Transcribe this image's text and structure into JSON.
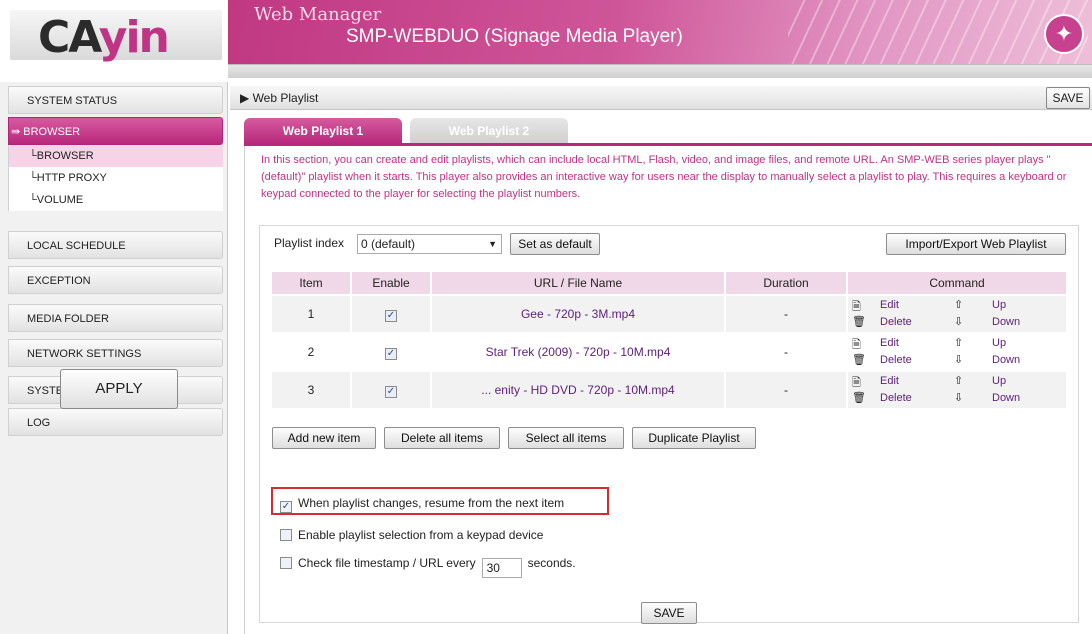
{
  "logo": {
    "text_a": "CA",
    "text_b": "yin"
  },
  "header": {
    "title": "Web Manager",
    "subtitle": "SMP-WEBDUO (Signage Media Player)",
    "badge_icon": "wand-icon"
  },
  "sidebar": {
    "items": [
      {
        "label": "SYSTEM STATUS"
      },
      {
        "label": "BROWSER"
      },
      {
        "label": "LOCAL SCHEDULE"
      },
      {
        "label": "EXCEPTION"
      },
      {
        "label": "MEDIA FOLDER"
      },
      {
        "label": "NETWORK SETTINGS"
      },
      {
        "label": "SYSTEM"
      },
      {
        "label": "LOG"
      }
    ],
    "subitems": [
      {
        "label": "BROWSER"
      },
      {
        "label": "HTTP PROXY"
      },
      {
        "label": "VOLUME"
      }
    ],
    "apply_label": "APPLY"
  },
  "breadcrumb": "Web Playlist",
  "top_save_label": "SAVE",
  "tabs": [
    {
      "label": "Web Playlist 1"
    },
    {
      "label": "Web Playlist 2"
    }
  ],
  "description": "In this section, you can create and edit playlists, which can include local HTML, Flash, video, and image files, and remote URL. An SMP-WEB series player plays \"(default)\" playlist when it starts. This player also provides an interactive way for users near the display to manually select a playlist to play. This requires a keyboard or keypad connected to the player for selecting the playlist numbers.",
  "playlist": {
    "index_label": "Playlist index",
    "index_value": "0 (default)",
    "set_default_label": "Set as default",
    "import_export_label": "Import/Export Web Playlist",
    "columns": [
      "Item",
      "Enable",
      "URL / File Name",
      "Duration",
      "Command"
    ],
    "rows": [
      {
        "item": "1",
        "file": "Gee - 720p - 3M.mp4",
        "duration": "-"
      },
      {
        "item": "2",
        "file": "Star Trek (2009) - 720p - 10M.mp4",
        "duration": "-"
      },
      {
        "item": "3",
        "file": "... enity - HD DVD - 720p - 10M.mp4",
        "duration": "-"
      }
    ],
    "commands": {
      "edit": "Edit",
      "delete": "Delete",
      "up": "Up",
      "down": "Down"
    }
  },
  "actions": {
    "add": "Add new item",
    "delete_all": "Delete all items",
    "select_all": "Select all items",
    "duplicate": "Duplicate Playlist"
  },
  "options": {
    "resume": "When playlist changes, resume from the next item",
    "keypad": "Enable playlist selection from a keypad device",
    "check_prefix": "Check file timestamp / URL every",
    "check_value": "30",
    "check_suffix": "seconds."
  },
  "bottom_save_label": "SAVE",
  "colors": {
    "accent": "#c03385",
    "tab_active": "#b8287b",
    "header_bg": "#cf5599",
    "highlight_border": "#d32f2f"
  }
}
